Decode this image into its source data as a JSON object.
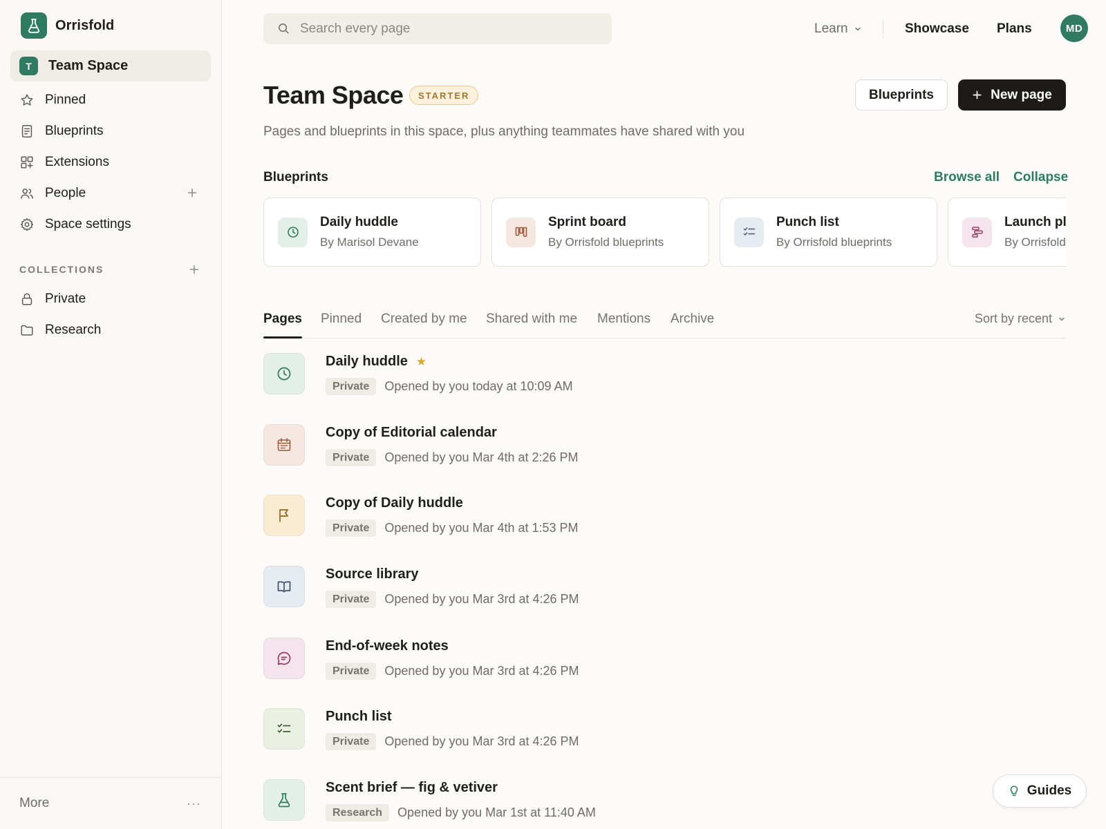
{
  "workspace": {
    "name": "Orrisfold"
  },
  "sidebar": {
    "current_space": {
      "initial": "T",
      "label": "Team Space"
    },
    "items": [
      {
        "label": "Pinned",
        "icon": "star-icon"
      },
      {
        "label": "Blueprints",
        "icon": "document-icon"
      },
      {
        "label": "Extensions",
        "icon": "extensions-icon"
      },
      {
        "label": "People",
        "icon": "people-icon"
      },
      {
        "label": "Space settings",
        "icon": "gear-icon"
      }
    ],
    "collections_title": "COLLECTIONS",
    "collections": [
      {
        "label": "Private",
        "icon": "lock-icon"
      },
      {
        "label": "Research",
        "icon": "folder-icon"
      }
    ],
    "footer": {
      "label": "More",
      "dots": "···"
    }
  },
  "topbar": {
    "search_placeholder": "Search every page",
    "learn": "Learn",
    "showcase": "Showcase",
    "plans": "Plans",
    "avatar_initials": "MD"
  },
  "header": {
    "title": "Team Space",
    "plan_badge": "STARTER",
    "blueprints_button": "Blueprints",
    "new_page_button": "New page",
    "subtitle": "Pages and blueprints in this space, plus anything teammates have shared with you"
  },
  "blueprints": {
    "title": "Blueprints",
    "browse_all": "Browse all",
    "collapse": "Collapse",
    "cards": [
      {
        "name": "Daily huddle",
        "author": "By Marisol Devane",
        "icon": "clock-icon"
      },
      {
        "name": "Sprint board",
        "author": "By Orrisfold blueprints",
        "icon": "kanban-icon"
      },
      {
        "name": "Punch list",
        "author": "By Orrisfold blueprints",
        "icon": "checklist-icon"
      },
      {
        "name": "Launch plan",
        "author": "By Orrisfold blueprints",
        "icon": "roadmap-icon"
      }
    ]
  },
  "tabs": [
    "Pages",
    "Pinned",
    "Created by me",
    "Shared with me",
    "Mentions",
    "Archive"
  ],
  "sort_label": "Sort by recent",
  "pages": [
    {
      "name": "Daily huddle",
      "tag": "Private",
      "opened": "Opened by you today at 10:09 AM",
      "icon": "clock-icon",
      "starred": "★"
    },
    {
      "name": "Copy of Editorial calendar",
      "tag": "Private",
      "opened": "Opened by you Mar 4th at 2:26 PM",
      "icon": "calendar-icon"
    },
    {
      "name": "Copy of Daily huddle",
      "tag": "Private",
      "opened": "Opened by you Mar 4th at 1:53 PM",
      "icon": "flag-icon"
    },
    {
      "name": "Source library",
      "tag": "Private",
      "opened": "Opened by you Mar 3rd at 4:26 PM",
      "icon": "book-icon"
    },
    {
      "name": "End-of-week notes",
      "tag": "Private",
      "opened": "Opened by you Mar 3rd at 4:26 PM",
      "icon": "chat-icon"
    },
    {
      "name": "Punch list",
      "tag": "Private",
      "opened": "Opened by you Mar 3rd at 4:26 PM",
      "icon": "checklist-icon"
    },
    {
      "name": "Scent brief — fig & vetiver",
      "tag": "Research",
      "opened": "Opened by you Mar 1st at 11:40 AM",
      "icon": "flask-icon"
    }
  ],
  "guides_label": "Guides",
  "colors": {
    "accent": "#2f7a61",
    "dark_button": "#1c1b19",
    "badge_gold": "#a37825"
  }
}
